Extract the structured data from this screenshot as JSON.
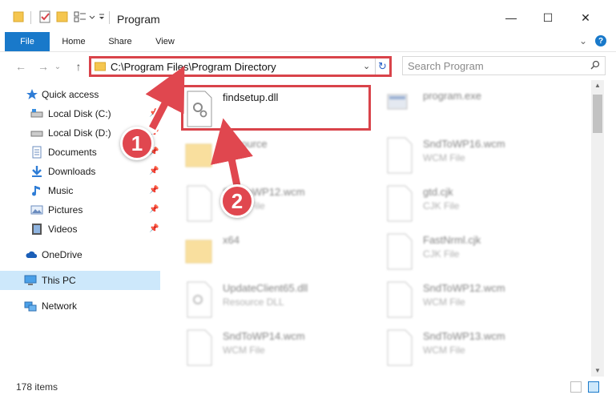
{
  "window": {
    "title": "Program",
    "minimize_glyph": "—",
    "maximize_glyph": "☐",
    "close_glyph": "✕"
  },
  "ribbon": {
    "tabs": [
      "File",
      "Home",
      "Share",
      "View"
    ],
    "collapse_glyph": "⌄",
    "help_glyph": "?"
  },
  "navigation": {
    "back_glyph": "←",
    "forward_glyph": "→",
    "recent_glyph": "⌄",
    "up_glyph": "↑"
  },
  "address": {
    "path": "C:\\Program Files\\Program Directory",
    "chevron_glyph": "⌄",
    "refresh_glyph": "↻"
  },
  "search": {
    "placeholder": "Search Program"
  },
  "sidebar": {
    "items": [
      {
        "label": "Quick access",
        "icon": "star-icon"
      },
      {
        "label": "Local Disk (C:)",
        "icon": "drive-icon"
      },
      {
        "label": "Local Disk (D:)",
        "icon": "drive-icon"
      },
      {
        "label": "Documents",
        "icon": "documents-icon"
      },
      {
        "label": "Downloads",
        "icon": "download-icon"
      },
      {
        "label": "Music",
        "icon": "music-icon"
      },
      {
        "label": "Pictures",
        "icon": "pictures-icon"
      },
      {
        "label": "Videos",
        "icon": "videos-icon"
      },
      {
        "label": "OneDrive",
        "icon": "cloud-icon"
      },
      {
        "label": "This PC",
        "icon": "computer-icon"
      },
      {
        "label": "Network",
        "icon": "network-icon"
      }
    ],
    "pin_glyph": "📌"
  },
  "files": {
    "items": [
      {
        "name": "findsetup.dll",
        "type": ""
      },
      {
        "name": "program.exe",
        "type": ""
      },
      {
        "name": "Resource",
        "type": ""
      },
      {
        "name": "SndToWP16.wcm",
        "type": "WCM File"
      },
      {
        "name": "SndToWP12.wcm",
        "type": "WCM File"
      },
      {
        "name": "gtd.cjk",
        "type": "CJK File"
      },
      {
        "name": "x64",
        "type": ""
      },
      {
        "name": "FastNrml.cjk",
        "type": "CJK File"
      },
      {
        "name": "UpdateClient65.dll",
        "type": "Resource DLL"
      },
      {
        "name": "SndToWP12.wcm",
        "type": "WCM File"
      },
      {
        "name": "SndToWP14.wcm",
        "type": "WCM File"
      },
      {
        "name": "SndToWP13.wcm",
        "type": "WCM File"
      }
    ]
  },
  "callouts": {
    "one": "1",
    "two": "2"
  },
  "status": {
    "item_count": "178 items"
  },
  "colors": {
    "accent": "#1979ca",
    "highlight": "#d9434a",
    "callout": "#e0474f",
    "selected": "#cde8fb"
  }
}
